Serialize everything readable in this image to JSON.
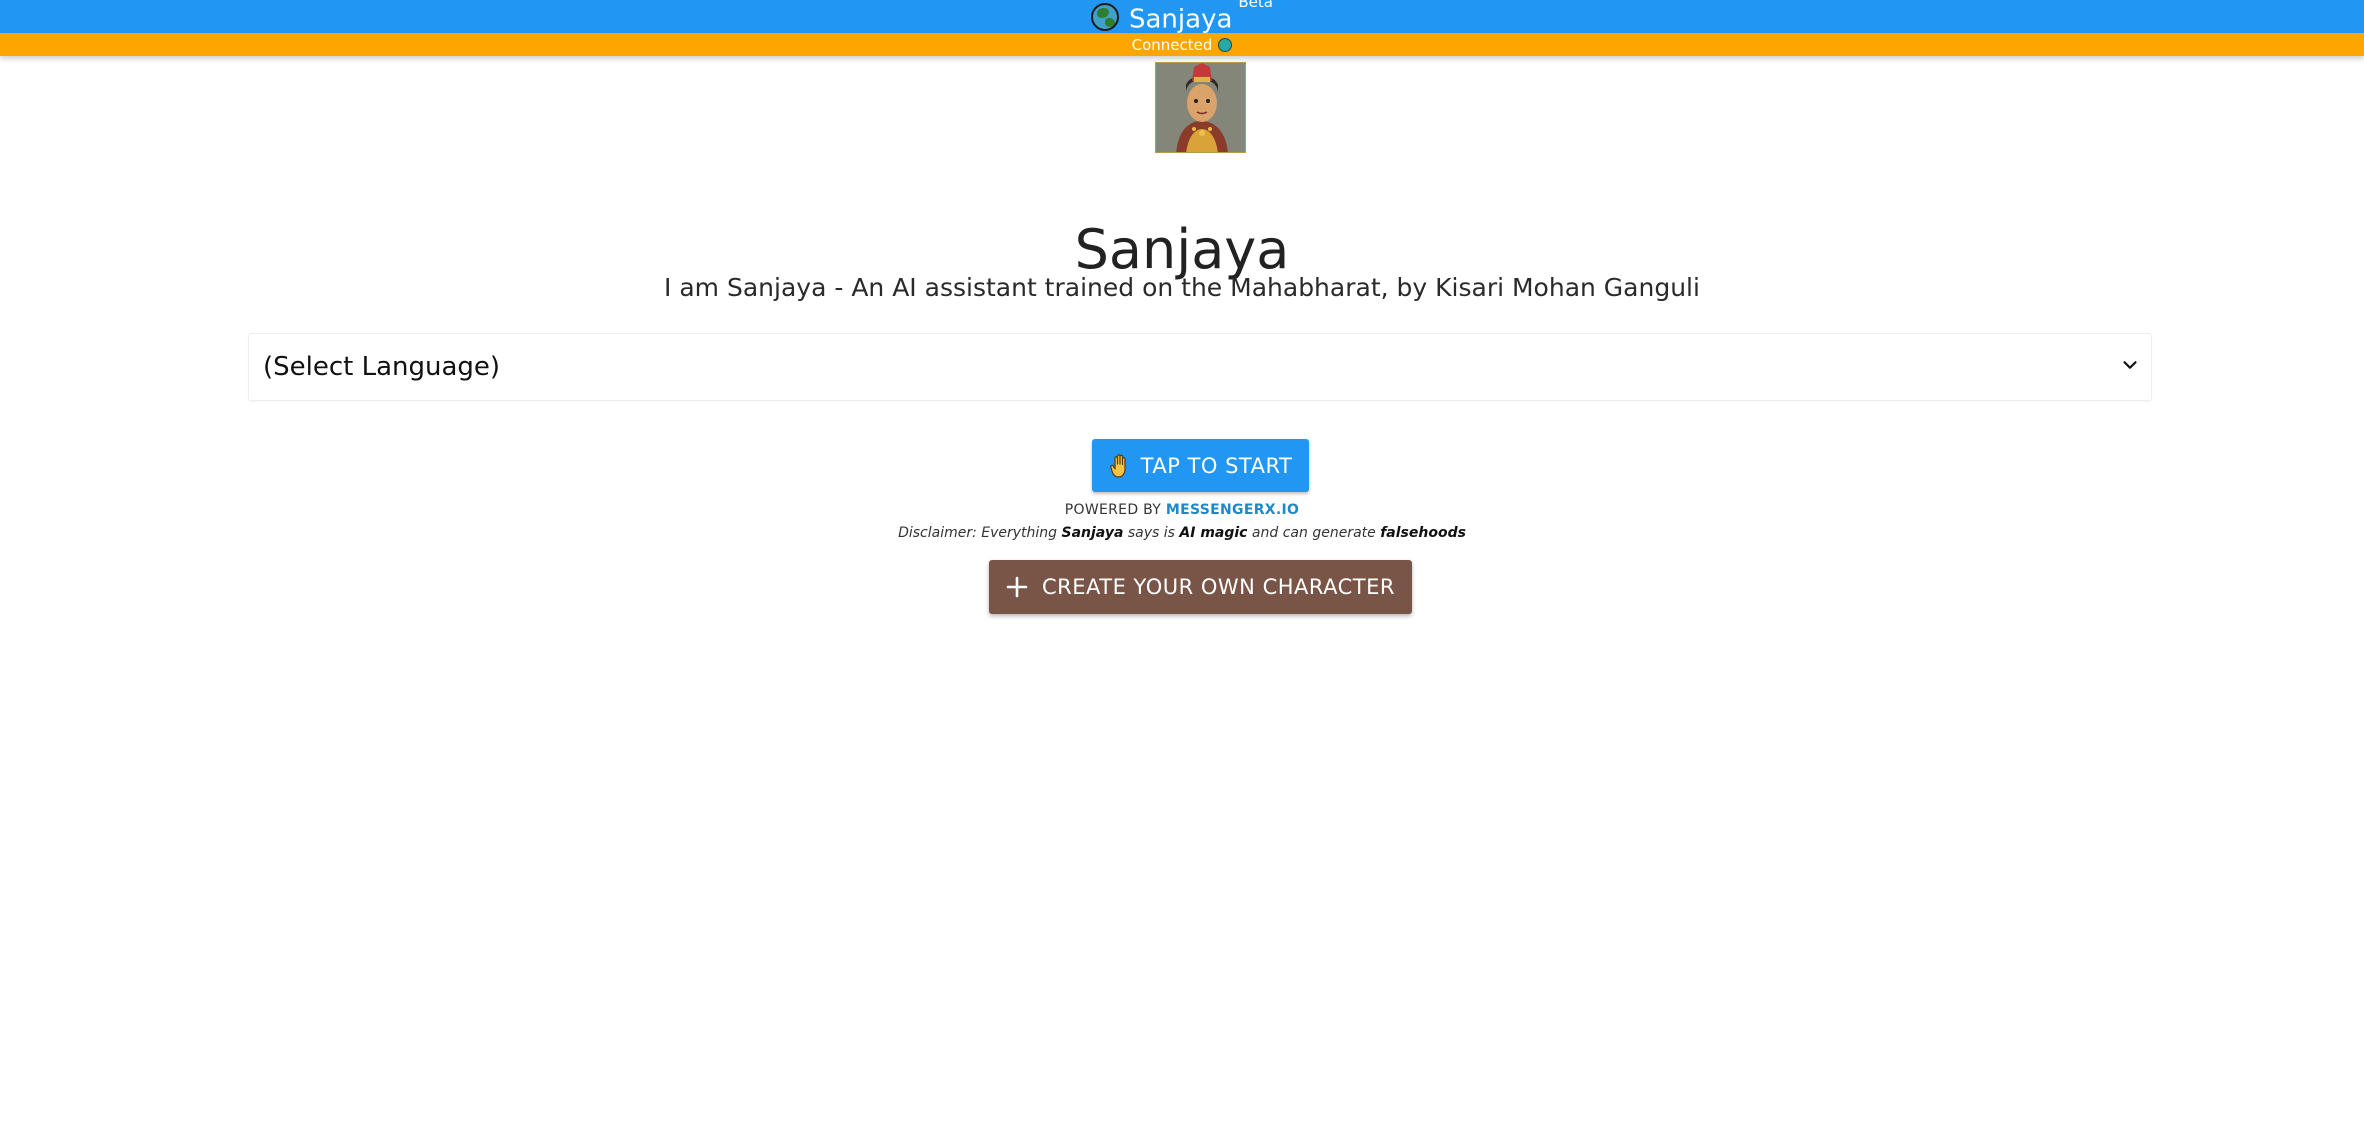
{
  "colors": {
    "app_bar": "#2196f3",
    "status_bar": "#ffa500",
    "start_button": "#2196f3",
    "create_button": "#795548",
    "brand_link": "#1e88c8",
    "globe_water": "#3fa0c8",
    "globe_land": "#2f7d32",
    "status_dot": "#2aa7a7",
    "hand": "#f5c542"
  },
  "header": {
    "app_name": "Sanjaya",
    "badge": "Beta",
    "globe_icon": "globe-icon"
  },
  "status": {
    "text": "Connected",
    "indicator_icon": "status-dot-icon"
  },
  "avatar": {
    "icon": "avatar-portrait"
  },
  "main": {
    "title": "Sanjaya",
    "subtitle": "I am Sanjaya - An AI assistant trained on the Mahabharat, by Kisari Mohan Ganguli"
  },
  "language_select": {
    "selected": "(Select Language)",
    "icon": "chevron-down-icon"
  },
  "start_button": {
    "label": "TAP TO START",
    "icon": "hand-icon"
  },
  "powered": {
    "prefix": "POWERED BY",
    "brand": "MESSENGERX.IO"
  },
  "disclaimer": {
    "part1": "Disclaimer: Everything ",
    "name": "Sanjaya",
    "part2": " says is ",
    "magic": "AI magic",
    "part3": " and can generate ",
    "falsehoods": "falsehoods"
  },
  "create_button": {
    "label": "CREATE YOUR OWN CHARACTER",
    "icon": "plus-icon"
  }
}
